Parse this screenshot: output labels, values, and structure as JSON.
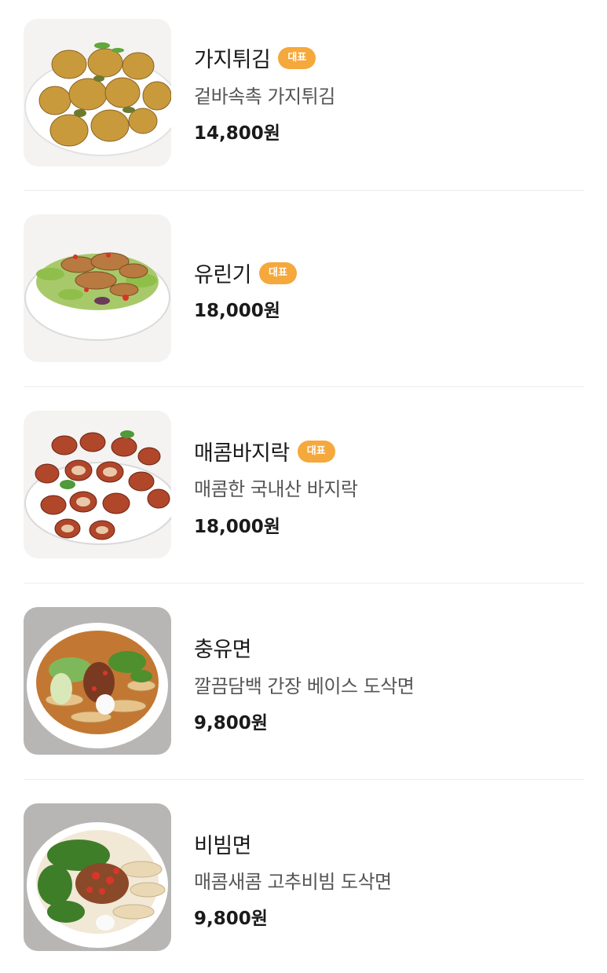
{
  "menu": {
    "items": [
      {
        "name": "가지튀김",
        "badge": "대표",
        "description": "겉바속촉 가지튀김",
        "price": "14,800원",
        "image": "fried-eggplant-photo"
      },
      {
        "name": "유린기",
        "badge": "대표",
        "description": "",
        "price": "18,000원",
        "image": "yuringi-fried-chicken-salad-photo"
      },
      {
        "name": "매콤바지락",
        "badge": "대표",
        "description": "매콤한 국내산 바지락",
        "price": "18,000원",
        "image": "spicy-clams-photo"
      },
      {
        "name": "충유면",
        "badge": "",
        "description": "깔끔담백 간장 베이스 도삭면",
        "price": "9,800원",
        "image": "soy-sauce-knife-cut-noodle-soup-photo"
      },
      {
        "name": "비빔면",
        "badge": "",
        "description": "매콤새콤 고추비빔 도삭면",
        "price": "9,800원",
        "image": "spicy-bibim-knife-cut-noodles-photo"
      }
    ]
  },
  "colors": {
    "badge": "#f5a83c",
    "divider": "#ececec",
    "text": "#1a1a1a",
    "description": "#555555"
  }
}
